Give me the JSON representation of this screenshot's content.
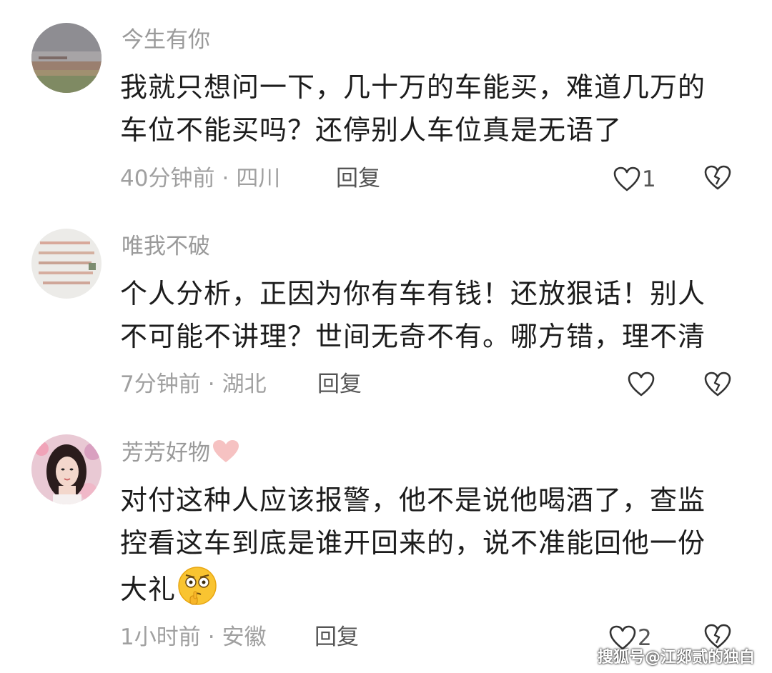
{
  "comments": [
    {
      "username": "今生有你",
      "text_line1": "我就只想问一下，几十万的车能买，难道几万的",
      "text_line2": "车位不能买吗？还停别人车位真是无语了",
      "time": "40分钟前",
      "dot": "·",
      "location": "四川",
      "reply_label": "回复",
      "like_count": "1"
    },
    {
      "username": "唯我不破",
      "text_line1": "个人分析，正因为你有车有钱！还放狠话！别人",
      "text_line2": "不可能不讲理？世间无奇不有。哪方错，理不清",
      "time": "7分钟前",
      "dot": "·",
      "location": "湖北",
      "reply_label": "回复",
      "like_count": ""
    },
    {
      "username": "芳芳好物",
      "username_emoji": "pink-heart-icon",
      "text_line1": "对付这种人应该报警，他不是说他喝酒了，查监",
      "text_line2": "控看这车到底是谁开回来的，说不准能回他一份",
      "text_line3": "大礼",
      "text_emoji": "thinking-face-icon",
      "time": "1小时前",
      "dot": "·",
      "location": "安徽",
      "reply_label": "回复",
      "like_count": "2"
    }
  ],
  "watermark": "搜狐号@江郯贰的独白",
  "colors": {
    "meta_gray": "#a0a0a0",
    "text": "#1c1c1c",
    "heart_pink": "#f4b8b8"
  }
}
